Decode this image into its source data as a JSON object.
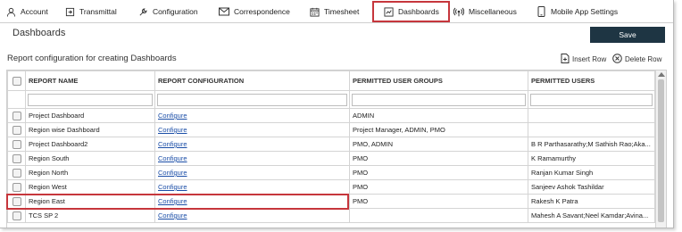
{
  "tabs": [
    {
      "label": "Account",
      "icon": "user-icon"
    },
    {
      "label": "Transmittal",
      "icon": "transmittal-icon"
    },
    {
      "label": "Configuration",
      "icon": "wrench-icon"
    },
    {
      "label": "Correspondence",
      "icon": "mail-icon"
    },
    {
      "label": "Timesheet",
      "icon": "calendar-icon"
    },
    {
      "label": "Dashboards",
      "icon": "dashboard-icon",
      "active": true
    },
    {
      "label": "Miscellaneous",
      "icon": "broadcast-icon"
    },
    {
      "label": "Mobile App Settings",
      "icon": "mobile-icon"
    }
  ],
  "header": {
    "title": "Dashboards",
    "save_label": "Save"
  },
  "toolbar": {
    "subtitle": "Report configuration for creating Dashboards",
    "insert_row": "Insert Row",
    "delete_row": "Delete Row"
  },
  "table": {
    "columns": [
      "REPORT NAME",
      "REPORT CONFIGURATION",
      "PERMITTED USER GROUPS",
      "PERMITTED USERS"
    ],
    "rows": [
      {
        "name": "Project Dashboard",
        "config": "Configure",
        "groups": "ADMIN",
        "users": ""
      },
      {
        "name": "Region wise Dashboard",
        "config": "Configure",
        "groups": "Project Manager, ADMIN, PMO",
        "users": ""
      },
      {
        "name": "Project Dashboard2",
        "config": "Configure",
        "groups": "PMO, ADMIN",
        "users": "B R Parthasarathy;M Sathish Rao;Aka..."
      },
      {
        "name": "Region South",
        "config": "Configure",
        "groups": "PMO",
        "users": "K Ramamurthy"
      },
      {
        "name": "Region North",
        "config": "Configure",
        "groups": "PMO",
        "users": "Ranjan Kumar Singh"
      },
      {
        "name": "Region West",
        "config": "Configure",
        "groups": "PMO",
        "users": "Sanjeev Ashok Tashildar"
      },
      {
        "name": "Region East",
        "config": "Configure",
        "groups": "PMO",
        "users": "Rakesh K Patra"
      },
      {
        "name": "TCS SP 2",
        "config": "Configure",
        "groups": "",
        "users": "Mahesh A Savant;Neel Kamdar;Avina..."
      }
    ]
  },
  "colors": {
    "accent": "#1e3543",
    "highlight": "#c6363c",
    "link": "#1b4ea7"
  }
}
